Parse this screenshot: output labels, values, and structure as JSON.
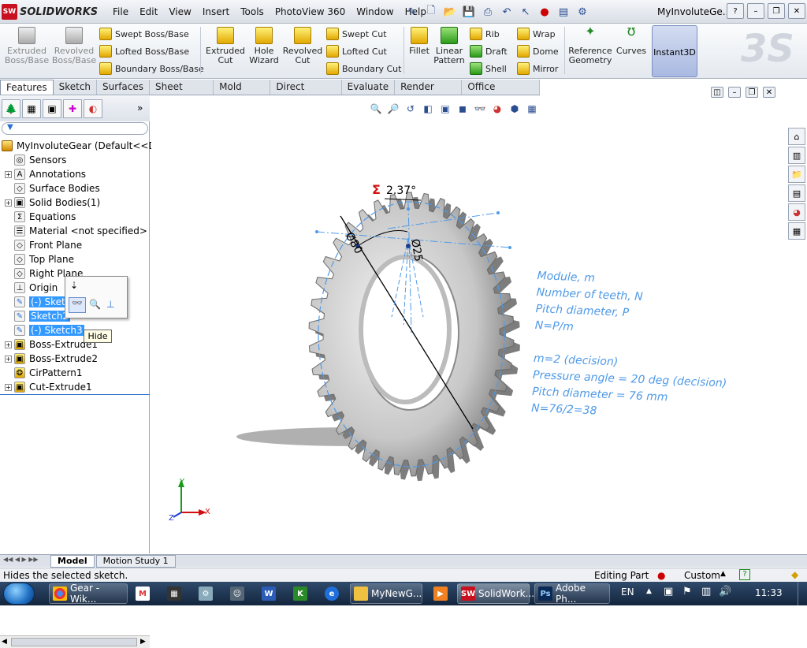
{
  "app": {
    "brand": "SOLIDWORKS",
    "logo_text": "SW",
    "doc_title": "MyInvoluteGe..."
  },
  "menu": [
    "File",
    "Edit",
    "View",
    "Insert",
    "Tools",
    "PhotoView 360",
    "Window",
    "Help"
  ],
  "commands": {
    "extruded_boss": "Extruded Boss/Base",
    "revolved_boss": "Revolved Boss/Base",
    "swept_boss": "Swept Boss/Base",
    "lofted_boss": "Lofted Boss/Base",
    "boundary_boss": "Boundary Boss/Base",
    "extruded_cut": "Extruded Cut",
    "hole_wizard": "Hole Wizard",
    "revolved_cut": "Revolved Cut",
    "swept_cut": "Swept Cut",
    "lofted_cut": "Lofted Cut",
    "boundary_cut": "Boundary Cut",
    "fillet": "Fillet",
    "linear_pattern": "Linear Pattern",
    "rib": "Rib",
    "draft": "Draft",
    "shell": "Shell",
    "wrap": "Wrap",
    "dome": "Dome",
    "mirror": "Mirror",
    "reference_geometry": "Reference Geometry",
    "curves": "Curves",
    "instant3d": "Instant3D"
  },
  "tabs": [
    "Features",
    "Sketch",
    "Surfaces",
    "Sheet Metal",
    "Mold Tools",
    "Direct Editing",
    "Evaluate",
    "Render Tools",
    "Office Products"
  ],
  "tree": {
    "root": "MyInvoluteGear  (Default<<Def",
    "items": [
      {
        "label": "Sensors",
        "expand": false
      },
      {
        "label": "Annotations",
        "expand": true
      },
      {
        "label": "Surface Bodies",
        "expand": false
      },
      {
        "label": "Solid Bodies(1)",
        "expand": true
      },
      {
        "label": "Equations",
        "expand": false
      },
      {
        "label": "Material <not specified>",
        "expand": false
      },
      {
        "label": "Front Plane",
        "expand": false
      },
      {
        "label": "Top Plane",
        "expand": false
      },
      {
        "label": "Right Plane",
        "expand": false
      },
      {
        "label": "Origin",
        "expand": false
      },
      {
        "label": "(-) Sketch1",
        "expand": false
      },
      {
        "label": "Sketch2",
        "expand": false
      },
      {
        "label": "(-) Sketch3",
        "expand": false
      },
      {
        "label": "Boss-Extrude1",
        "expand": true
      },
      {
        "label": "Boss-Extrude2",
        "expand": true
      },
      {
        "label": "CirPattern1",
        "expand": false
      },
      {
        "label": "Cut-Extrude1",
        "expand": true
      }
    ]
  },
  "tooltip": "Hide",
  "viewport": {
    "dim_angle": "2.37°",
    "dim_dia1": "Ø80",
    "dim_dia2": "Ø25",
    "sigma": "Σ",
    "axis_x": "X",
    "axis_y": "Y",
    "axis_z": "Z",
    "notes": [
      "Module, m",
      "Number of teeth, N",
      "Pitch diameter, P",
      "N=P/m",
      "",
      "m=2 (decision)",
      "Pressure angle = 20 deg (decision)",
      "Pitch diameter = 76 mm",
      "N=76/2=38"
    ],
    "accent": "#4f9ae8"
  },
  "bottom_tabs": [
    "Model",
    "Motion Study 1"
  ],
  "status": {
    "message": "Hides the selected sketch.",
    "mode": "Editing Part",
    "units": "Custom"
  },
  "taskbar": {
    "items": [
      "Gear - Wik...",
      "MyNewG...",
      "SolidWork...",
      "Adobe Ph..."
    ],
    "lang": "EN",
    "time": "11:33"
  }
}
